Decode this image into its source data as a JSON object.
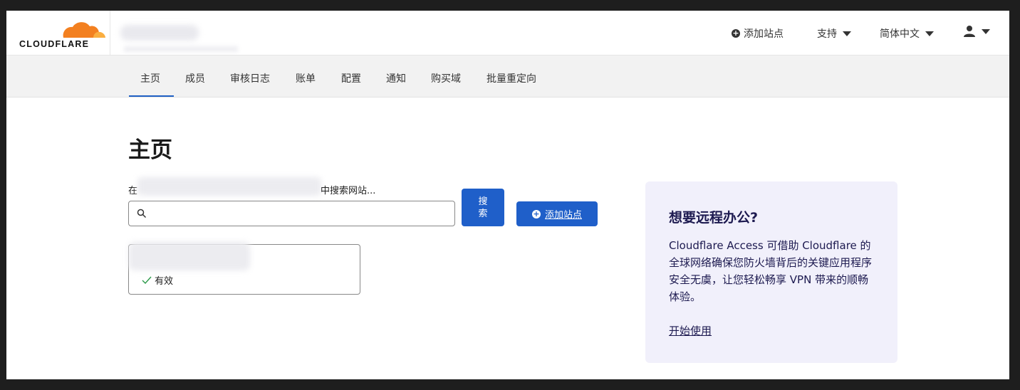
{
  "brand": {
    "name": "CLOUDFLARE",
    "accent": "#f38020"
  },
  "header": {
    "add_site": "添加站点",
    "support": "支持",
    "language": "简体中文"
  },
  "nav": {
    "items": [
      "主页",
      "成员",
      "审核日志",
      "账单",
      "配置",
      "通知",
      "购买域",
      "批量重定向"
    ]
  },
  "main": {
    "title": "主页",
    "search_label_prefix": "在",
    "search_label_suffix": "中搜索网站...",
    "search_value": "",
    "search_button": "搜索",
    "add_site_button": "添加站点",
    "site_status": "有效"
  },
  "promo": {
    "title": "想要远程办公?",
    "body": "Cloudflare Access 可借助 Cloudflare 的全球网络确保您防火墙背后的关键应用程序安全无虞，让您轻松畅享 VPN 带来的顺畅体验。",
    "link": "开始使用"
  },
  "colors": {
    "primary": "#1f5fc9",
    "nav_bg": "#f2f2f2",
    "promo_bg": "#f1f0fb"
  }
}
